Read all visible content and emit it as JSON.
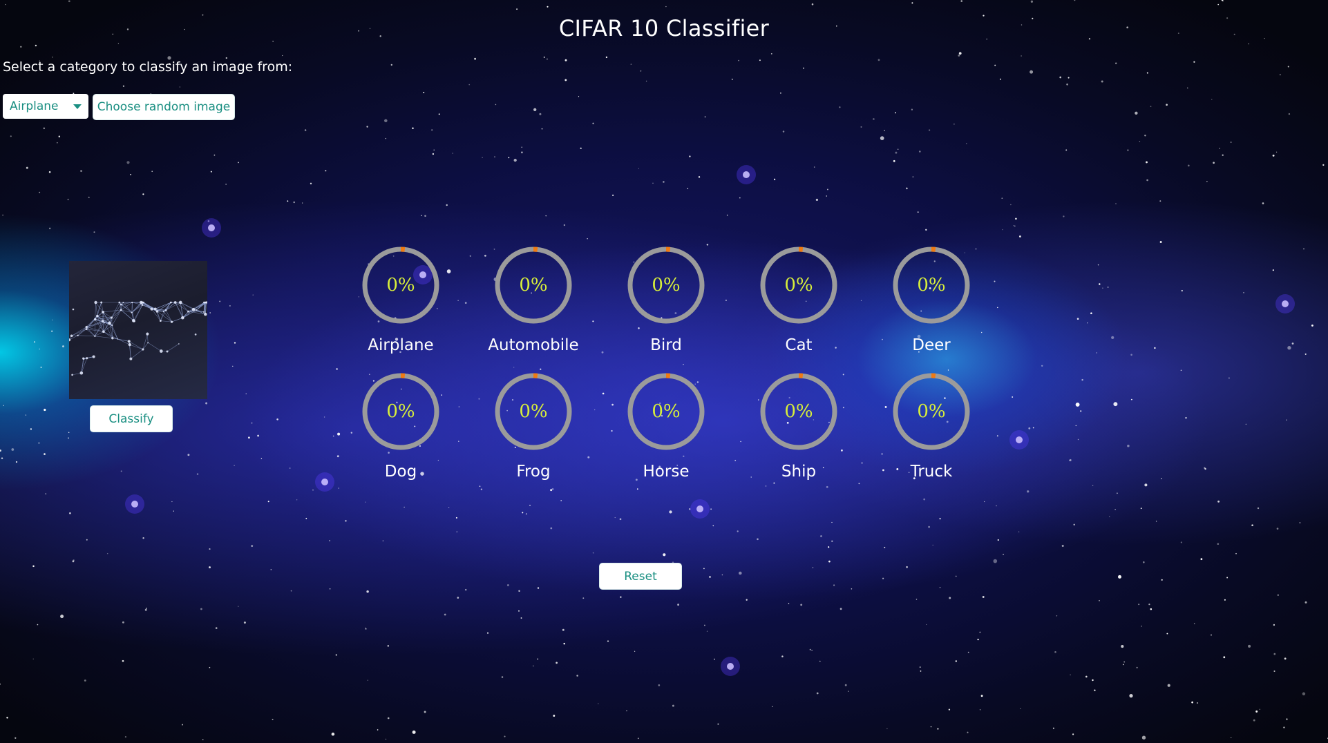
{
  "page": {
    "title": "CIFAR 10 Classifier",
    "instruction": "Select a category to classify an image from:"
  },
  "controls": {
    "category_select": {
      "selected": "Airplane",
      "icon": "chevron-down-icon"
    },
    "random_button_label": "Choose random image",
    "classify_button_label": "Classify",
    "reset_button_label": "Reset"
  },
  "predictions": [
    {
      "label": "Airplane",
      "value_text": "0%",
      "progress": 0
    },
    {
      "label": "Automobile",
      "value_text": "0%",
      "progress": 0
    },
    {
      "label": "Bird",
      "value_text": "0%",
      "progress": 0
    },
    {
      "label": "Cat",
      "value_text": "0%",
      "progress": 0
    },
    {
      "label": "Deer",
      "value_text": "0%",
      "progress": 0
    },
    {
      "label": "Dog",
      "value_text": "0%",
      "progress": 0
    },
    {
      "label": "Frog",
      "value_text": "0%",
      "progress": 0
    },
    {
      "label": "Horse",
      "value_text": "0%",
      "progress": 0
    },
    {
      "label": "Ship",
      "value_text": "0%",
      "progress": 0
    },
    {
      "label": "Truck",
      "value_text": "0%",
      "progress": 0
    }
  ],
  "colors": {
    "accent": "#1a8f82",
    "gauge_track": "#9b9b9b",
    "gauge_progress": "#f07a12",
    "gauge_text": "#d8ef3a"
  }
}
